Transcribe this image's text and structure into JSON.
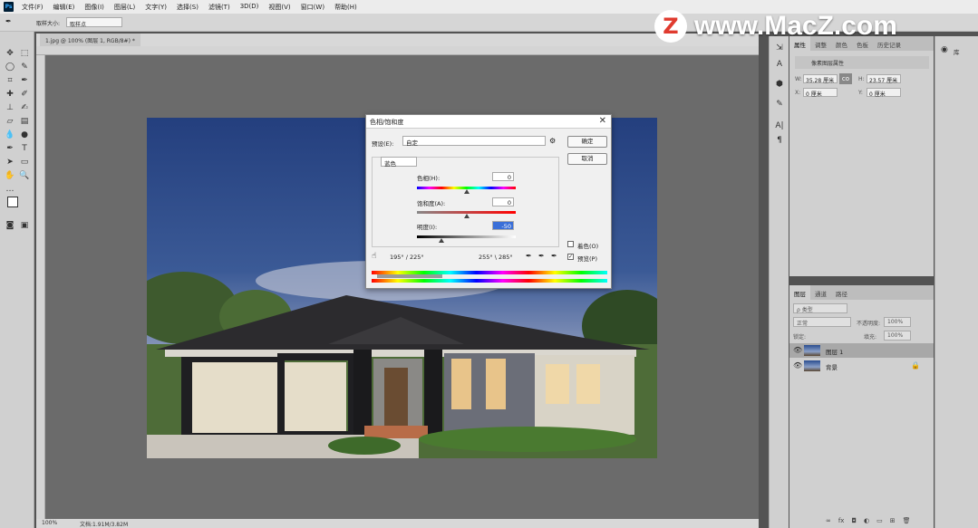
{
  "menubar": {
    "app_icon": "Ps",
    "items": [
      "文件(F)",
      "编辑(E)",
      "图像(I)",
      "图层(L)",
      "文字(Y)",
      "选择(S)",
      "滤镜(T)",
      "3D(D)",
      "视图(V)",
      "窗口(W)",
      "帮助(H)"
    ]
  },
  "options": {
    "sample_label": "取样大小:",
    "sample_value": "取样点"
  },
  "document": {
    "tab_title": "1.jpg @ 100% (图层 1, RGB/8#) *",
    "zoom": "100%",
    "doc_info": "文档:1.91M/3.82M"
  },
  "watermark": {
    "logo_letter": "Z",
    "text": "www.MacZ.com"
  },
  "properties": {
    "tabs": [
      "属性",
      "调整",
      "颜色",
      "色板",
      "历史记录"
    ],
    "pixel_layer_label": "像素图层属性",
    "w_label": "W:",
    "w_value": "35.28 厘米",
    "h_label": "H:",
    "h_value": "23.57 厘米",
    "x_label": "X:",
    "x_value": "0 厘米",
    "y_label": "Y:",
    "y_value": "0 厘米",
    "link_icon": "co"
  },
  "far_right": {
    "lib_label": "库"
  },
  "layers": {
    "tabs": [
      "图层",
      "通道",
      "路径"
    ],
    "filter_label": "ρ 类型",
    "blend_mode": "正常",
    "opacity_label": "不透明度:",
    "opacity_value": "100%",
    "lock_label": "锁定:",
    "fill_label": "填充:",
    "fill_value": "100%",
    "items": [
      {
        "name": "图层 1",
        "locked": false,
        "selected": true
      },
      {
        "name": "背景",
        "locked": true,
        "selected": false
      }
    ],
    "bottom_icons": [
      "∞",
      "fx",
      "◘",
      "◐",
      "▭",
      "⊞",
      "🗑"
    ]
  },
  "dialog": {
    "title": "色相/饱和度",
    "preset_label": "预设(E):",
    "preset_value": "自定",
    "channel_value": "蓝色",
    "hue_label": "色相(H):",
    "hue_value": "0",
    "sat_label": "饱和度(A):",
    "sat_value": "0",
    "light_label": "明度(I):",
    "light_value": "-50",
    "ok_label": "确定",
    "cancel_label": "取消",
    "colorize_label": "着色(O)",
    "preview_label": "预览(P)",
    "colorize_checked": false,
    "preview_checked": true,
    "range_left": "195° / 225°",
    "range_right": "255° \\ 285°",
    "hue_slider_pct": 0.5,
    "sat_slider_pct": 0.5,
    "light_slider_pct": 0.25
  }
}
